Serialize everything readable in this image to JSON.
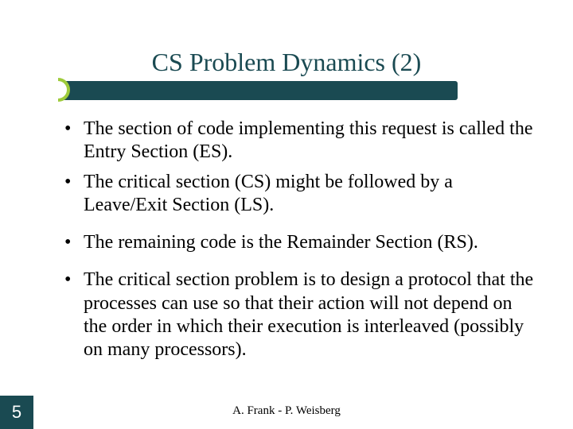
{
  "slide": {
    "title": "CS Problem Dynamics (2)",
    "bullets": [
      "The section of code implementing this request is called the Entry Section (ES).",
      "The critical section (CS) might be followed by a Leave/Exit Section (LS).",
      "The remaining code is the Remainder Section (RS).",
      "The critical section problem is to design a protocol that the processes can use so that their action will not depend on the order in which their execution is interleaved (possibly on many processors)."
    ],
    "page_number": "5",
    "footer": "A. Frank - P. Weisberg"
  }
}
